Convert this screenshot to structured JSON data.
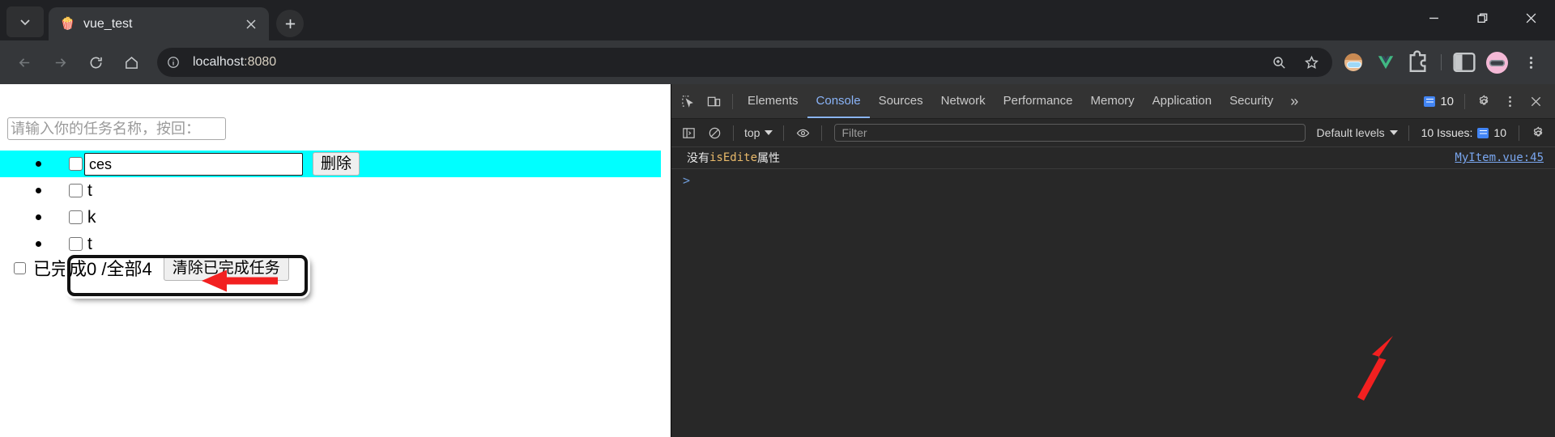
{
  "browser": {
    "tab": {
      "title": "vue_test",
      "favicon": "popcorn-icon"
    },
    "tab_list_label": "⌄",
    "newtab_label": "+",
    "window_controls": {
      "minimize": "minimize-icon",
      "maximize": "maximize-icon",
      "close": "close-icon"
    },
    "toolbar": {
      "back": "back-icon",
      "forward": "forward-icon",
      "reload": "reload-icon",
      "home": "home-icon",
      "site_info": "info-icon",
      "url_host": "localhost",
      "url_port": ":8080",
      "zoom": "zoom-in-icon",
      "bookmark": "star-icon",
      "extension_avatar": "avatar-extension-icon",
      "extension_vue": "vue-devtools-icon",
      "extensions": "puzzle-icon",
      "side_panel": "side-panel-icon",
      "profile": "profile-avatar",
      "menu": "three-dot-menu-icon"
    }
  },
  "page": {
    "add_input": {
      "placeholder": "请输入你的任务名称，按回：",
      "value": ""
    },
    "items": [
      {
        "text": "ces",
        "editing": true,
        "checked": false,
        "delete_label": "删除"
      },
      {
        "text": "t",
        "editing": false,
        "checked": false
      },
      {
        "text": "k",
        "editing": false,
        "checked": false
      },
      {
        "text": "t",
        "editing": false,
        "checked": false
      }
    ],
    "footer": {
      "all_checkbox_checked": false,
      "status": "已完成0 /全部4",
      "clear_label": "清除已完成任务"
    },
    "annotation": {
      "highlight_color": "#00ffff",
      "arrow_color": "#f22020",
      "box_color": "#111111"
    }
  },
  "devtools": {
    "inspect_icon": "inspect-element-icon",
    "device_icon": "device-toolbar-icon",
    "tabs": [
      {
        "label": "Elements",
        "active": false
      },
      {
        "label": "Console",
        "active": true
      },
      {
        "label": "Sources",
        "active": false
      },
      {
        "label": "Network",
        "active": false
      },
      {
        "label": "Performance",
        "active": false
      },
      {
        "label": "Memory",
        "active": false
      },
      {
        "label": "Application",
        "active": false
      },
      {
        "label": "Security",
        "active": false
      }
    ],
    "more_tabs": "»",
    "message_count": "10",
    "settings_icon": "gear-icon",
    "kebab_icon": "three-dot-menu-icon",
    "close_icon": "close-icon",
    "filterbar": {
      "sidebar_icon": "console-sidebar-icon",
      "clear_icon": "clear-console-icon",
      "context": "top",
      "eye_icon": "live-expression-icon",
      "filter_placeholder": "Filter",
      "levels": "Default levels",
      "issues_label": "10 Issues:",
      "issues_count": "10",
      "console_settings_icon": "gear-icon"
    },
    "console": {
      "message_prefix": "没有",
      "message_ident": "isEdite",
      "message_suffix": "属性",
      "source_link": "MyItem.vue:45",
      "prompt": ">"
    }
  }
}
